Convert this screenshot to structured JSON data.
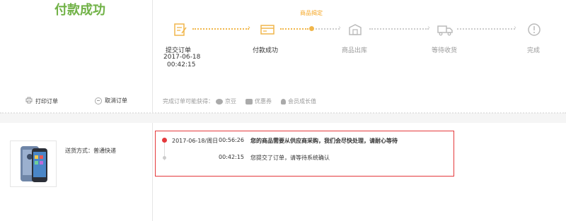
{
  "page": {
    "title": "付款成功"
  },
  "progress": {
    "current_status_label": "商品揭定",
    "steps": [
      {
        "label": "提交订单",
        "date": "2017-06-18",
        "time": "00:42:15",
        "icon": "submit-order-icon",
        "done": true
      },
      {
        "label": "付款成功",
        "icon": "payment-card-icon",
        "done": true
      },
      {
        "label": "商品出库",
        "icon": "warehouse-box-icon",
        "done": false
      },
      {
        "label": "等待收货",
        "icon": "delivery-truck-icon",
        "done": false
      },
      {
        "label": "完成",
        "icon": "complete-check-icon",
        "done": false
      }
    ]
  },
  "actions": {
    "print_label": "打印订单",
    "cancel_label": "取消订单"
  },
  "benefits": {
    "intro": "完成订单可能获得：",
    "items": [
      {
        "label": "京豆",
        "icon": "jd-bean-icon"
      },
      {
        "label": "优惠券",
        "icon": "coupon-icon"
      },
      {
        "label": "会员成长值",
        "icon": "member-growth-icon"
      }
    ]
  },
  "order": {
    "shipping": "送货方式：普通快递",
    "tracking": [
      {
        "date": "2017-06-18/周日",
        "time": "00:56:26",
        "message": "您的商品需要从供应商采购，我们会尽快处理，请耐心等待",
        "bold": true
      },
      {
        "date": "",
        "time": "00:42:15",
        "message": "您提交了订单，请等待系统确认",
        "bold": false
      }
    ]
  },
  "colors": {
    "title_green": "#71b247",
    "accent_orange": "#f5a623",
    "highlight_red": "#e4393c"
  }
}
